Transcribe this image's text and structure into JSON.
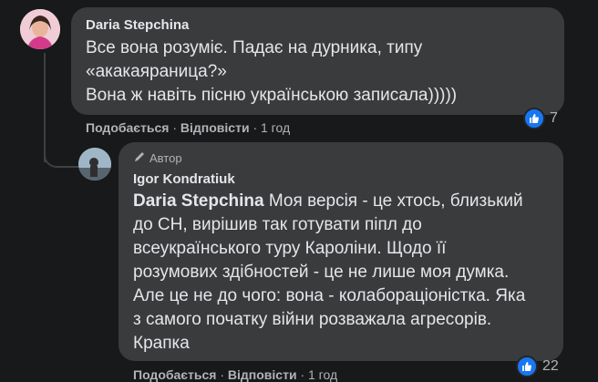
{
  "comment_1": {
    "author": "Daria Stepchina",
    "lines": [
      "Все вона розуміє. Падає на дурника, типу",
      "«акакаяраница?»",
      "Вона ж навіть пісню українською записала)))))"
    ],
    "actions": {
      "like": "Подобається",
      "reply": "Відповісти",
      "sep": "·",
      "time": "1 год"
    },
    "reactions_count": "7"
  },
  "comment_2": {
    "badge": "Автор",
    "author": "Igor Kondratiuk",
    "mention": "Daria Stepchina",
    "first_line_rest": " Моя версія - це хтось, близький",
    "lines": [
      "до СН, вирішив так готувати піпл до",
      "всеукраїнського туру Кароліни. Щодо її",
      "розумових здібностей - це не лише моя думка.",
      "Але це не до чого: вона - колабораціоністка. Яка",
      "з самого початку війни розважала агресорів.",
      "Крапка"
    ],
    "actions": {
      "like": "Подобається",
      "reply": "Відповісти",
      "sep": "·",
      "time": "1 год"
    },
    "reactions_count": "22"
  },
  "icons": {
    "like": "thumbs-up-icon",
    "author_badge": "pen-icon"
  },
  "colors": {
    "background": "#18191a",
    "bubble": "#3a3b3c",
    "text": "#e4e6eb",
    "secondary": "#b0b3b8",
    "like_blue": "#1877f2"
  }
}
